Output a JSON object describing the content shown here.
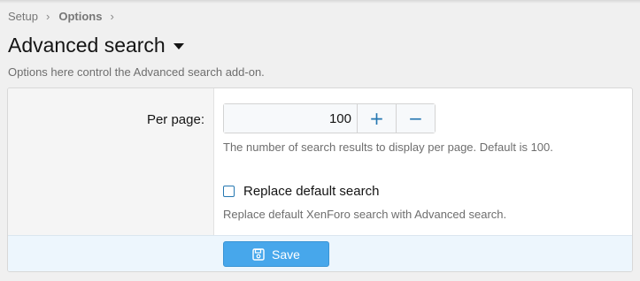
{
  "breadcrumb": {
    "items": [
      "Setup",
      "Options"
    ],
    "separator": "›"
  },
  "page": {
    "title": "Advanced search",
    "description": "Options here control the Advanced search add-on."
  },
  "options": {
    "per_page": {
      "label": "Per page:",
      "value": "100",
      "plus_symbol": "+",
      "minus_symbol": "−",
      "hint": "The number of search results to display per page. Default is 100."
    },
    "replace_default": {
      "label": "Replace default search",
      "checked": false,
      "hint": "Replace default XenForo search with Advanced search."
    }
  },
  "footer": {
    "save_label": "Save",
    "save_icon": "save-icon"
  },
  "colors": {
    "accent": "#47a7eb",
    "link": "#2577b1",
    "footer_bg": "#edf6fd"
  }
}
